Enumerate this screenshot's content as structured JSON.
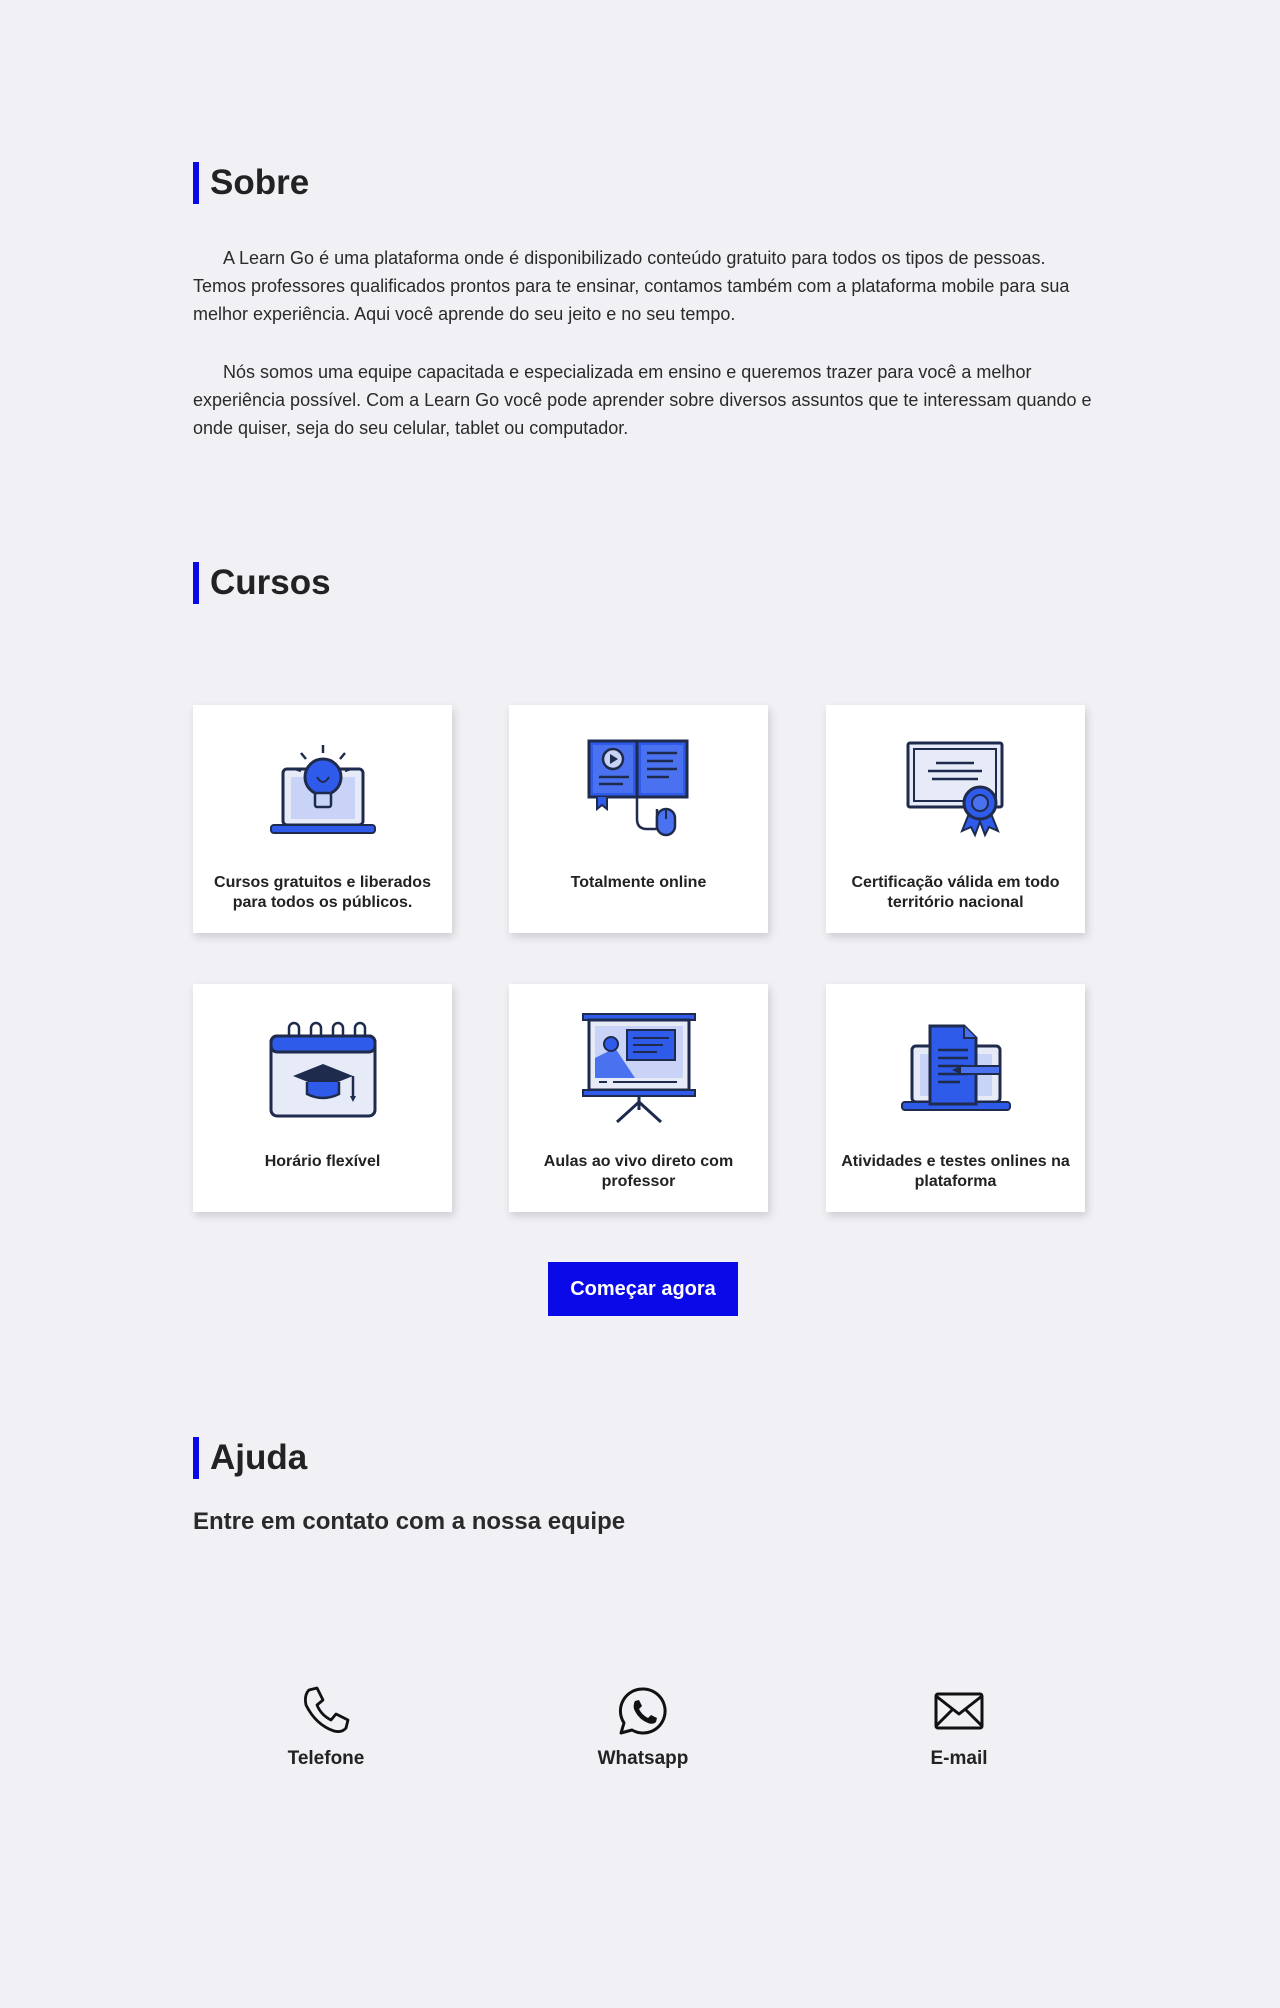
{
  "sobre": {
    "title": "Sobre",
    "paragraphs": [
      "A Learn Go é uma plataforma onde é disponibilizado conteúdo gratuito para todos os tipos de pessoas. Temos professores qualificados prontos para te ensinar, contamos também com a plataforma mobile para sua melhor experiência. Aqui você aprende do seu jeito e no seu tempo.",
      "Nós somos uma equipe capacitada e especializada em ensino e queremos trazer para você a melhor experiência possível. Com a Learn Go você pode aprender sobre diversos assuntos que te interessam quando e onde quiser, seja do seu celular, tablet ou computador."
    ]
  },
  "cursos": {
    "title": "Cursos",
    "cards": [
      {
        "label": "Cursos gratuitos e liberados para todos os públicos.",
        "icon": "laptop-lightbulb-icon"
      },
      {
        "label": "Totalmente online",
        "icon": "book-mouse-icon"
      },
      {
        "label": "Certificação válida em todo território nacional",
        "icon": "certificate-icon"
      },
      {
        "label": "Horário flexível",
        "icon": "calendar-graduation-icon"
      },
      {
        "label": "Aulas ao vivo direto com professor",
        "icon": "presentation-board-icon"
      },
      {
        "label": "Atividades e testes onlines na plataforma",
        "icon": "laptop-document-icon"
      }
    ],
    "cta_label": "Começar agora"
  },
  "ajuda": {
    "title": "Ajuda",
    "subtitle": "Entre em contato com a nossa equipe",
    "contacts": [
      {
        "label": "Telefone",
        "icon": "phone-icon"
      },
      {
        "label": "Whatsapp",
        "icon": "whatsapp-icon"
      },
      {
        "label": "E-mail",
        "icon": "envelope-icon"
      }
    ]
  },
  "colors": {
    "accent": "#0a0ae8",
    "icon_blue": "#2f5bea",
    "icon_light": "#c9d3f7",
    "background": "#f0f0f5"
  }
}
